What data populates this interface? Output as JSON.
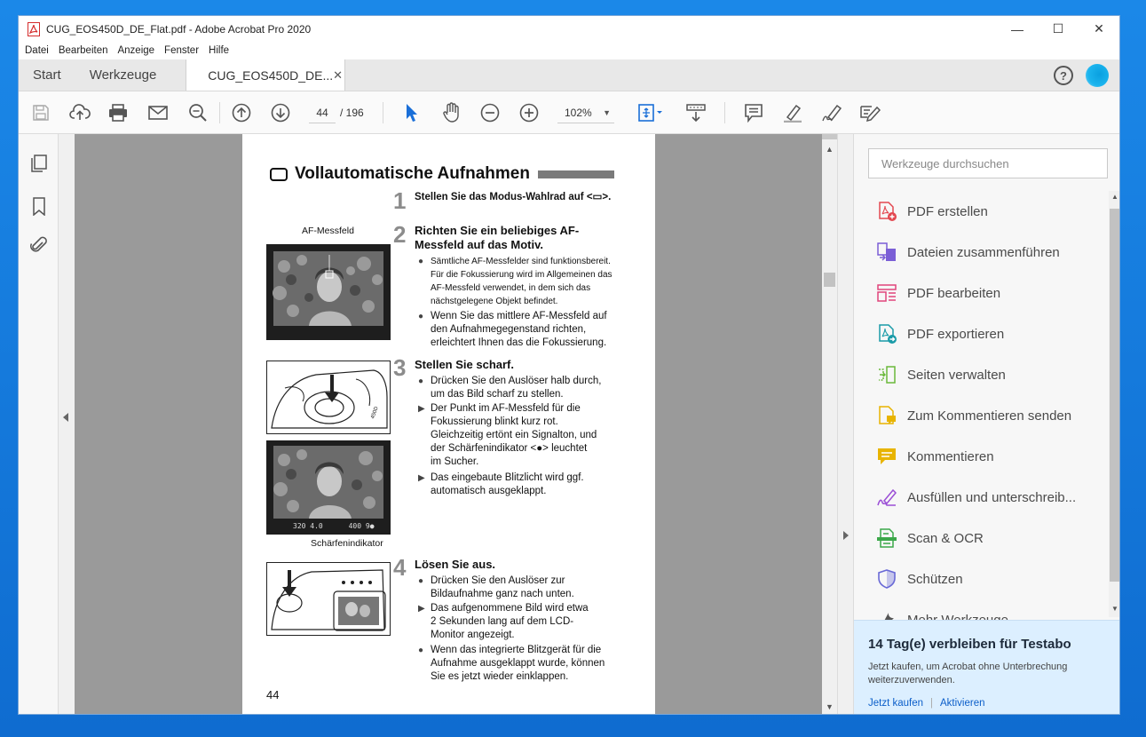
{
  "window": {
    "title": "CUG_EOS450D_DE_Flat.pdf - Adobe Acrobat Pro 2020",
    "controls": {
      "minimize": "—",
      "maximize": "☐",
      "close": "✕"
    }
  },
  "menu": {
    "items": [
      "Datei",
      "Bearbeiten",
      "Anzeige",
      "Fenster",
      "Hilfe"
    ]
  },
  "tabs": {
    "start": "Start",
    "tools": "Werkzeuge",
    "document": "CUG_EOS450D_DE...",
    "close": "✕",
    "help": "?"
  },
  "toolbar": {
    "page_current": "44",
    "page_total": "/ 196",
    "zoom": "102%"
  },
  "right_panel": {
    "search_placeholder": "Werkzeuge durchsuchen",
    "tools": [
      {
        "label": "PDF erstellen",
        "icon": "pdf-create-icon",
        "color": "#e34850"
      },
      {
        "label": "Dateien zusammenführen",
        "icon": "combine-files-icon",
        "color": "#7b5fd6"
      },
      {
        "label": "PDF bearbeiten",
        "icon": "pdf-edit-icon",
        "color": "#e0457b"
      },
      {
        "label": "PDF exportieren",
        "icon": "pdf-export-icon",
        "color": "#1a9ba8"
      },
      {
        "label": "Seiten verwalten",
        "icon": "organize-pages-icon",
        "color": "#6ab83a"
      },
      {
        "label": "Zum Kommentieren senden",
        "icon": "send-comments-icon",
        "color": "#e8b400"
      },
      {
        "label": "Kommentieren",
        "icon": "comment-icon",
        "color": "#e8b400"
      },
      {
        "label": "Ausfüllen und unterschreib...",
        "icon": "fill-sign-icon",
        "color": "#9b4fd6"
      },
      {
        "label": "Scan & OCR",
        "icon": "scan-ocr-icon",
        "color": "#3ca84a"
      },
      {
        "label": "Schützen",
        "icon": "protect-icon",
        "color": "#6a6ad6"
      },
      {
        "label": "Mehr Werkzeuge",
        "icon": "more-tools-icon",
        "color": "#555555"
      }
    ],
    "trial": {
      "title": "14 Tag(e) verbleiben für Testabo",
      "text": "Jetzt kaufen, um Acrobat ohne Unterbrechung weiterzuverwenden.",
      "buy": "Jetzt kaufen",
      "activate": "Aktivieren"
    }
  },
  "document": {
    "title": "Vollautomatische Aufnahmen",
    "step1": {
      "num": "1",
      "text": "Stellen Sie das Modus-Wahlrad auf <▭>."
    },
    "step2": {
      "num": "2",
      "title_l1": "Richten Sie ein beliebiges AF-",
      "title_l2": "Messfeld auf das Motiv.",
      "b1": [
        "Sämtliche AF-Messfelder sind funktionsbereit.",
        "Für die Fokussierung wird im Allgemeinen das",
        "AF-Messfeld verwendet, in dem sich das",
        "nächstgelegene Objekt befindet."
      ],
      "b2": [
        "Wenn Sie das mittlere AF-Messfeld auf",
        "den Aufnahmegegenstand richten,",
        "erleichtert Ihnen das die Fokussierung."
      ]
    },
    "caption_af": "AF-Messfeld",
    "step3": {
      "num": "3",
      "title": "Stellen Sie scharf.",
      "b1": [
        "Drücken Sie den Auslöser halb durch,",
        "um das Bild scharf zu stellen."
      ],
      "b2": [
        "Der Punkt im AF-Messfeld für die",
        "Fokussierung blinkt kurz rot.",
        "Gleichzeitig ertönt ein Signalton, und",
        "der Schärfenindikator <●> leuchtet",
        "im Sucher."
      ],
      "b3": [
        "Das eingebaute Blitzlicht wird ggf.",
        "automatisch ausgeklappt."
      ]
    },
    "viewfinder_info": "320 4.0      400 9●",
    "caption_focus": "Schärfenindikator",
    "step4": {
      "num": "4",
      "title": "Lösen Sie aus.",
      "b1": [
        "Drücken Sie den Auslöser zur",
        "Bildaufnahme ganz nach unten."
      ],
      "b2": [
        "Das aufgenommene Bild wird etwa",
        "2 Sekunden lang auf dem LCD-",
        "Monitor angezeigt."
      ],
      "b3": [
        "Wenn das integrierte Blitzgerät für die",
        "Aufnahme ausgeklappt wurde, können",
        "Sie es jetzt wieder einklappen."
      ]
    },
    "page_number": "44"
  }
}
